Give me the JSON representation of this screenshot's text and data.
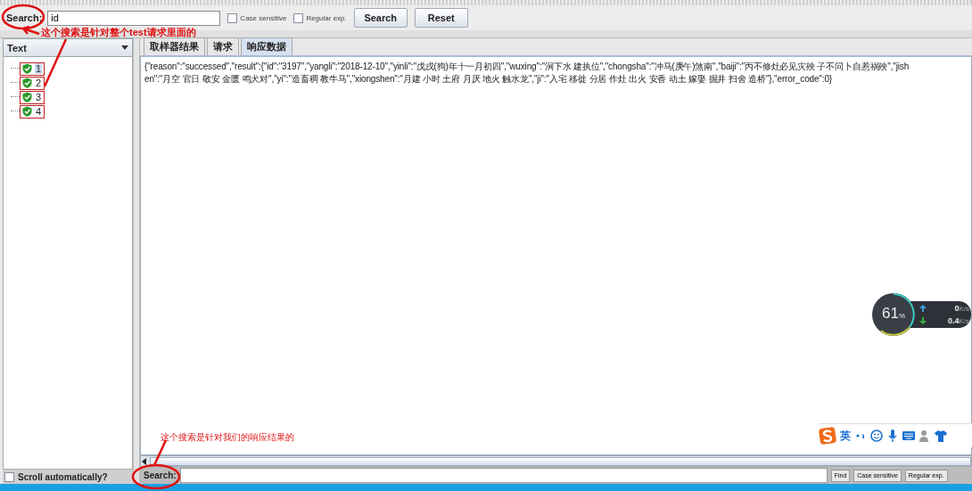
{
  "search_bar": {
    "label": "Search:",
    "value": "id",
    "options": [
      {
        "label": "Case sensitive",
        "checked": false
      },
      {
        "label": "Regular exp.",
        "checked": false
      }
    ],
    "buttons": [
      "Search",
      "Reset"
    ]
  },
  "left_panel": {
    "renderer": "Text",
    "results": [
      {
        "label": "1",
        "selected": true
      },
      {
        "label": "2",
        "selected": false
      },
      {
        "label": "3",
        "selected": false
      },
      {
        "label": "4",
        "selected": false
      }
    ],
    "scroll_automatically": {
      "label": "Scroll automatically?",
      "checked": false
    }
  },
  "tabs": [
    {
      "label": "取样器结果",
      "selected": false
    },
    {
      "label": "请求",
      "selected": false
    },
    {
      "label": "响应数据",
      "selected": true
    }
  ],
  "response_lines": [
    "{\"reason\":\"successed\",\"result\":{\"id\":\"3197\",\"yangli\":\"2018-12-10\",\"yinli\":\"戊戌(狗)年十一月初四\",\"wuxing\":\"涧下水 建执位\",\"chongsha\":\"冲马(庚午)煞南\",\"baiji\":\"丙不修灶必见灾殃 子不问卜自惹祸殃\",\"jish",
    "en\":\"月空 官日 敬安 金匮 鸣犬对\",\"yi\":\"造畜稠 教牛马\",\"xiongshen\":\"月建 小时 土府 月厌 地火 触水龙\",\"ji\":\"入宅 移徙 分居 作灶 出火 安香 动土 嫁娶 掘井 扫舍 造桥\"},\"error_code\":0}"
  ],
  "response_search": {
    "label": "Search:",
    "buttons": [
      "Find",
      "Case sensitive",
      "Regular exp."
    ]
  },
  "annotations": [
    {
      "text": "这个搜索是针对整个test请求里面的"
    },
    {
      "text": "这个搜索是针对我们的响应结果的"
    }
  ],
  "net_monitor": {
    "percent": "61",
    "unit": "%",
    "upload": "0",
    "upload_unit": "K/s",
    "download": "0.4",
    "download_unit": "K/s"
  },
  "ime_toolbar": {
    "mode": "英"
  }
}
